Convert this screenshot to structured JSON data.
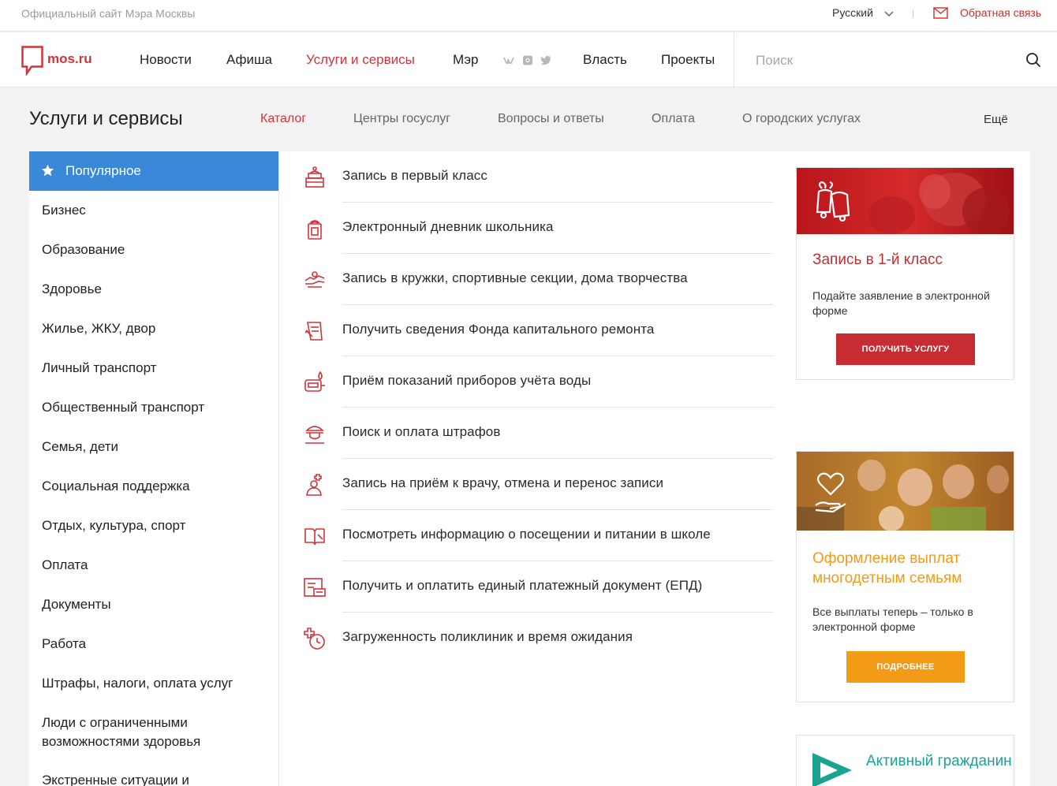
{
  "topbar": {
    "site_name": "Официальный сайт Мэра Москвы",
    "language": "Русский",
    "feedback": "Обратная связь"
  },
  "header": {
    "logo_text": "mos.ru",
    "nav": [
      "Новости",
      "Афиша",
      "Услуги и сервисы",
      "Мэр",
      "Власть",
      "Проекты"
    ],
    "active_nav": "Услуги и сервисы",
    "social_icons": [
      "vk-icon",
      "instagram-icon",
      "twitter-icon"
    ],
    "search_placeholder": "Поиск"
  },
  "section": {
    "title": "Услуги и сервисы",
    "subnav": [
      "Каталог",
      "Центры госуслуг",
      "Вопросы и ответы",
      "Оплата",
      "О городских услугах",
      "Ещё"
    ],
    "active_subnav": "Каталог"
  },
  "categories": [
    "Популярное",
    "Бизнес",
    "Образование",
    "Здоровье",
    "Жилье, ЖКУ, двор",
    "Личный транспорт",
    "Общественный транспорт",
    "Семья, дети",
    "Социальная поддержка",
    "Отдых, культура, спорт",
    "Оплата",
    "Документы",
    "Работа",
    "Штрафы, налоги, оплата услуг",
    "Люди с ограниченными возможностями здоровья",
    "Экстренные ситуации и"
  ],
  "services": [
    {
      "label": "Запись в первый класс",
      "icon": "school-bell-icon"
    },
    {
      "label": "Электронный дневник школьника",
      "icon": "diary-icon"
    },
    {
      "label": "Запись в кружки, спортивные секции, дома творчества",
      "icon": "hobby-icon"
    },
    {
      "label": "Получить сведения Фонда капитального ремонта",
      "icon": "repair-fund-icon"
    },
    {
      "label": "Приём показаний приборов учёта воды",
      "icon": "water-meter-icon"
    },
    {
      "label": "Поиск и оплата штрафов",
      "icon": "police-cap-icon"
    },
    {
      "label": "Запись на приём к врачу, отмена и перенос записи",
      "icon": "doctor-icon"
    },
    {
      "label": "Посмотреть информацию о посещении и питании в школе",
      "icon": "book-icon"
    },
    {
      "label": "Получить и оплатить единый платежный документ (ЕПД)",
      "icon": "payment-document-icon"
    },
    {
      "label": "Загруженность поликлиник и время ожидания",
      "icon": "clinic-clock-icon"
    }
  ],
  "promos": [
    {
      "title": "Запись в 1-й класс",
      "text": "Подайте заявление в электронной форме",
      "button": "ПОЛУЧИТЬ УСЛУГУ",
      "icon": "bells-icon",
      "accent": "#c62c32"
    },
    {
      "title": "Оформление выплат многодетным семьям",
      "text": "Все выплаты теперь – только в электронной форме",
      "button": "ПОДРОБНЕЕ",
      "icon": "heart-hand-icon",
      "accent": "#f39a17"
    },
    {
      "title": "Активный гражданин",
      "icon": "active-citizen-logo",
      "accent": "#1aa392"
    }
  ],
  "colors": {
    "brand_red": "#d3333a",
    "active_blue": "#3a89d9",
    "orange": "#f39a17",
    "teal": "#1aa392"
  }
}
